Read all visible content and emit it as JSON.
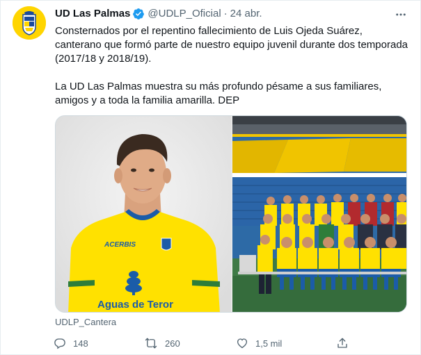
{
  "tweet": {
    "author_name": "UD Las Palmas",
    "author_handle": "@UDLP_Oficial",
    "separator": "·",
    "date": "24 abr.",
    "text_para1": "Consternados por el repentino fallecimiento de Luis Ojeda Suárez, canterano que formó parte de nuestro equipo juvenil durante dos temporada (2017/18 y 2018/19).",
    "text_para2": "La UD Las Palmas muestra su más profundo pésame a sus familiares, amigos y a toda la familia amarilla. DEP",
    "media_source": "UDLP_Cantera",
    "shirt_brand": "ACERBIS",
    "shirt_sponsor": "Aguas de Teror"
  },
  "actions": {
    "reply_count": "148",
    "retweet_count": "260",
    "like_count": "1,5 mil"
  },
  "icons": {
    "verified": "verified-badge-icon",
    "more": "more-dots-icon",
    "reply": "reply-icon",
    "retweet": "retweet-icon",
    "like": "heart-icon",
    "share": "share-icon"
  },
  "colors": {
    "verified_blue": "#1d9bf0",
    "secondary_text": "#536471",
    "jersey_yellow": "#ffe100",
    "jersey_blue": "#1b5ca8"
  }
}
